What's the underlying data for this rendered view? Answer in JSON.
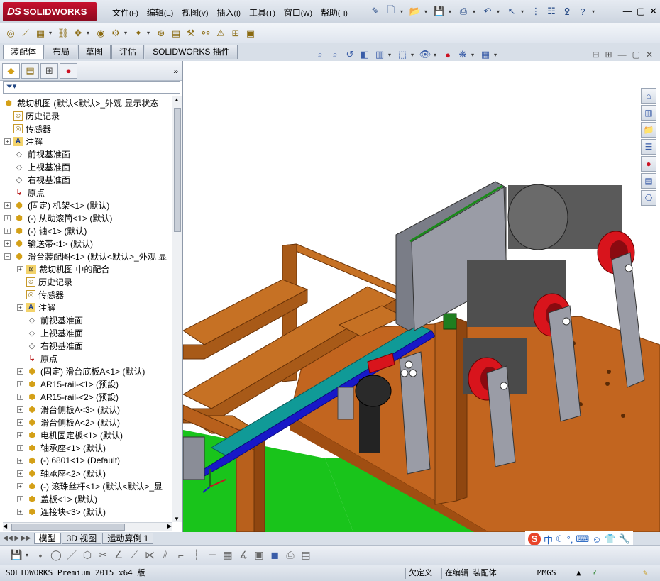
{
  "app": {
    "logo_text": "SOLIDWORKS",
    "logo_prefix": "DS"
  },
  "menu": [
    {
      "label": "文件",
      "key": "(F)"
    },
    {
      "label": "编辑",
      "key": "(E)"
    },
    {
      "label": "视图",
      "key": "(V)"
    },
    {
      "label": "插入",
      "key": "(I)"
    },
    {
      "label": "工具",
      "key": "(T)"
    },
    {
      "label": "窗口",
      "key": "(W)"
    },
    {
      "label": "帮助",
      "key": "(H)"
    }
  ],
  "command_tabs": [
    "装配体",
    "布局",
    "草图",
    "评估",
    "SOLIDWORKS 插件"
  ],
  "tree": {
    "root": "裁切机图  (默认<默认>_外观 显示状态",
    "items": [
      {
        "label": "历史记录",
        "icon": "history-icon",
        "level": 1,
        "expand": false
      },
      {
        "label": "传感器",
        "icon": "sensor-icon",
        "level": 1,
        "expand": false
      },
      {
        "label": "注解",
        "icon": "annotation-icon",
        "level": 1,
        "expand": "plus"
      },
      {
        "label": "前视基准面",
        "icon": "plane-icon",
        "level": 1,
        "expand": false
      },
      {
        "label": "上视基准面",
        "icon": "plane-icon",
        "level": 1,
        "expand": false
      },
      {
        "label": "右视基准面",
        "icon": "plane-icon",
        "level": 1,
        "expand": false
      },
      {
        "label": "原点",
        "icon": "origin-icon",
        "level": 1,
        "expand": false
      },
      {
        "label": "(固定) 机架<1> (默认)",
        "icon": "part-icon",
        "level": 1,
        "expand": "plus"
      },
      {
        "label": "(-) 从动滚筒<1> (默认)",
        "icon": "part-icon",
        "level": 1,
        "expand": "plus"
      },
      {
        "label": "(-) 轴<1> (默认)",
        "icon": "part-icon",
        "level": 1,
        "expand": "plus"
      },
      {
        "label": "输送带<1> (默认)",
        "icon": "part-icon",
        "level": 1,
        "expand": "plus"
      },
      {
        "label": "滑台装配图<1> (默认<默认>_外观 显",
        "icon": "assembly-icon",
        "level": 1,
        "expand": "minus"
      },
      {
        "label": "裁切机图 中的配合",
        "icon": "mate-icon",
        "level": 2,
        "expand": "plus"
      },
      {
        "label": "历史记录",
        "icon": "history-icon",
        "level": 2,
        "expand": false
      },
      {
        "label": "传感器",
        "icon": "sensor-icon",
        "level": 2,
        "expand": false
      },
      {
        "label": "注解",
        "icon": "annotation-icon",
        "level": 2,
        "expand": "plus"
      },
      {
        "label": "前视基准面",
        "icon": "plane-icon",
        "level": 2,
        "expand": false
      },
      {
        "label": "上视基准面",
        "icon": "plane-icon",
        "level": 2,
        "expand": false
      },
      {
        "label": "右视基准面",
        "icon": "plane-icon",
        "level": 2,
        "expand": false
      },
      {
        "label": "原点",
        "icon": "origin-icon",
        "level": 2,
        "expand": false
      },
      {
        "label": "(固定) 滑台底板A<1> (默认)",
        "icon": "part-icon",
        "level": 2,
        "expand": "plus"
      },
      {
        "label": "AR15-rail-<1> (预設)",
        "icon": "part-icon",
        "level": 2,
        "expand": "plus"
      },
      {
        "label": "AR15-rail-<2> (预設)",
        "icon": "part-icon",
        "level": 2,
        "expand": "plus"
      },
      {
        "label": "滑台侧板A<3> (默认)",
        "icon": "part-icon",
        "level": 2,
        "expand": "plus"
      },
      {
        "label": "滑台侧板A<2> (默认)",
        "icon": "part-icon",
        "level": 2,
        "expand": "plus"
      },
      {
        "label": "电机固定板<1> (默认)",
        "icon": "part-icon",
        "level": 2,
        "expand": "plus"
      },
      {
        "label": "轴承座<1> (默认)",
        "icon": "part-icon",
        "level": 2,
        "expand": "plus"
      },
      {
        "label": "(-) 6801<1> (Default)",
        "icon": "part-icon",
        "level": 2,
        "expand": "plus"
      },
      {
        "label": "轴承座<2> (默认)",
        "icon": "part-icon",
        "level": 2,
        "expand": "plus"
      },
      {
        "label": "(-) 滚珠丝杆<1> (默认<默认>_显",
        "icon": "part-icon",
        "level": 2,
        "expand": "plus"
      },
      {
        "label": "盖板<1> (默认)",
        "icon": "part-icon",
        "level": 2,
        "expand": "plus"
      },
      {
        "label": "连接块<3> (默认)",
        "icon": "part-icon",
        "level": 2,
        "expand": "plus"
      }
    ]
  },
  "model_tabs": [
    "模型",
    "3D 视图",
    "运动算例 1"
  ],
  "status": {
    "product": "SOLIDWORKS Premium 2015 x64 版",
    "underdefined": "欠定义",
    "editing": "在编辑 装配体",
    "units": "MMGS"
  },
  "ime": {
    "lang": "中"
  },
  "colors": {
    "frame_wood": "#b8601c",
    "plate_orange": "#c2651f",
    "floor_green": "#19c41b",
    "belt_teal": "#109a97",
    "rail_blue": "#1818c8",
    "roller_red": "#d8141c",
    "motor_gray": "#5a5a5a",
    "bracket_gray": "#9a9ca6",
    "panel_gray": "#8a8d97"
  }
}
